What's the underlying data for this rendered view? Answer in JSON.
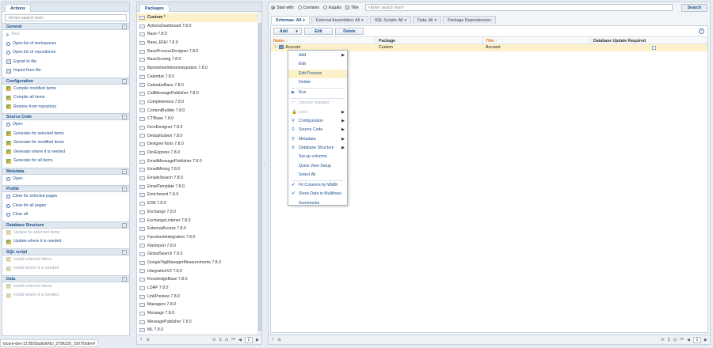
{
  "actions": {
    "tab_label": "Actions",
    "search_placeholder": "<Enter search text>",
    "groups": [
      {
        "title": "General",
        "items": [
          {
            "label": "Run",
            "icon": "run-icon",
            "disabled": true
          },
          {
            "label": "Open list of workspaces",
            "icon": "search-icon",
            "disabled": false
          },
          {
            "label": "Open list of repositories",
            "icon": "search-icon",
            "disabled": false
          },
          {
            "label": "Export to file",
            "icon": "export-icon",
            "disabled": false
          },
          {
            "label": "Import from file",
            "icon": "import-icon",
            "disabled": false
          }
        ]
      },
      {
        "title": "Configuration",
        "items": [
          {
            "label": "Compile modified items",
            "icon": "compile-icon",
            "disabled": false
          },
          {
            "label": "Compile all items",
            "icon": "compile-icon",
            "disabled": false
          },
          {
            "label": "Restore from repository",
            "icon": "restore-icon",
            "disabled": false
          }
        ]
      },
      {
        "title": "Source Code",
        "items": [
          {
            "label": "Open",
            "icon": "search-icon",
            "disabled": false
          },
          {
            "label": "Generate for selected items",
            "icon": "generate-icon",
            "disabled": false
          },
          {
            "label": "Generate for modified items",
            "icon": "generate-icon",
            "disabled": false
          },
          {
            "label": "Generate where it is needed",
            "icon": "generate-icon",
            "disabled": false
          },
          {
            "label": "Generate for all items",
            "icon": "generate-icon",
            "disabled": false
          }
        ]
      },
      {
        "title": "Metadata",
        "items": [
          {
            "label": "Open",
            "icon": "search-icon",
            "disabled": false
          }
        ]
      },
      {
        "title": "Profile",
        "items": [
          {
            "label": "Clear for selected pages",
            "icon": "search-icon",
            "disabled": false
          },
          {
            "label": "Clear for all pages",
            "icon": "search-icon",
            "disabled": false
          },
          {
            "label": "Clear all",
            "icon": "search-icon",
            "disabled": false
          }
        ]
      },
      {
        "title": "Database Structure",
        "items": [
          {
            "label": "Update for selected items",
            "icon": "database-icon",
            "disabled": true
          },
          {
            "label": "Update where it is needed",
            "icon": "database-icon",
            "disabled": false
          }
        ]
      },
      {
        "title": "SQL script",
        "items": [
          {
            "label": "Install selected items",
            "icon": "install-icon",
            "disabled": true
          },
          {
            "label": "Install where it is needed",
            "icon": "install-icon",
            "disabled": true
          }
        ]
      },
      {
        "title": "Data",
        "items": [
          {
            "label": "Install selected items",
            "icon": "install-icon",
            "disabled": true
          },
          {
            "label": "Install where it is needed",
            "icon": "install-icon",
            "disabled": true
          }
        ]
      }
    ]
  },
  "status_url": "tscore-dev-12:85/StudioENU_2796220_1007/0/dev#",
  "packages": {
    "tab_label": "Packages",
    "selected": "Custom *",
    "items": [
      "ActionsDashboard 7.8.0",
      "Base 7.8.0",
      "Base_ENU 7.8.0",
      "BaseProcessDesigner 7.8.0",
      "BaseScoring 7.8.0",
      "Bpmonline0nlineIntegration 7.8.0",
      "Calendar 7.8.0",
      "CalendarBase 7.8.0",
      "CallMessagePublisher 7.8.0",
      "Completeness 7.8.0",
      "ContentBuilder 7.8.0",
      "CTIBase 7.8.0",
      "DcmDesigner 7.8.0",
      "Deduplication 7.8.0",
      "DesignerTools 7.8.0",
      "DevExpress 7.8.0",
      "EmailMessagePublisher 7.8.0",
      "EmailMining 7.8.0",
      "EmailsSearch 7.8.0",
      "EmailTemplate 7.8.0",
      "Enrichment 7.8.0",
      "ESN 7.8.0",
      "Exchange 7.8.0",
      "ExchangeListener 7.8.0",
      "ExternalAccess 7.8.0",
      "FacebookIntegration 7.8.0",
      "FileImport 7.8.0",
      "GlobalSearch 7.8.0",
      "GoogleTagManagerMeasurements 7.8.0",
      "IntegrationV2 7.8.0",
      "KnowledgeBase 7.8.0",
      "LDAP 7.8.0",
      "LinkPreview 7.8.0",
      "Managers 7.8.0",
      "Message 7.8.0",
      "MessagePublisher 7.8.0",
      "ML 7.8.0"
    ],
    "pager_value": "1"
  },
  "filter": {
    "start_with": "Start with",
    "contains": "Contains",
    "equals": "Equals",
    "title": "Title",
    "search_placeholder": "<Enter search text>",
    "search_button": "Search"
  },
  "tabs": [
    {
      "label": "Schemas: All",
      "active": true
    },
    {
      "label": "External Assemblies: All",
      "active": false
    },
    {
      "label": "SQL Scripts: All",
      "active": false
    },
    {
      "label": "Data: All",
      "active": false
    },
    {
      "label": "Package Dependencies",
      "active": false
    }
  ],
  "toolbar": {
    "add": "Add",
    "edit": "Edit",
    "delete": "Delete"
  },
  "grid": {
    "columns": [
      "Name",
      "Package",
      "Title",
      "Database Update Required"
    ],
    "rows": [
      {
        "name": "Account",
        "package": "Custom",
        "title": "Account",
        "db_update": false
      }
    ]
  },
  "context_menu": [
    {
      "label": "Add",
      "submenu": true,
      "disabled": false
    },
    {
      "label": "Edit",
      "submenu": false,
      "disabled": false
    },
    {
      "label": "Edit Process",
      "submenu": false,
      "disabled": false,
      "hover": true
    },
    {
      "label": "Delete",
      "submenu": false,
      "disabled": false
    },
    {
      "sep": true
    },
    {
      "label": "Run",
      "submenu": false,
      "disabled": false,
      "lead": "run"
    },
    {
      "sep": true
    },
    {
      "label": "Discard changes",
      "submenu": false,
      "disabled": true,
      "lead": "undo"
    },
    {
      "label": "Lock",
      "submenu": true,
      "disabled": true,
      "lead": "lock"
    },
    {
      "label": "Configuration",
      "submenu": true,
      "disabled": false,
      "lead": "search"
    },
    {
      "label": "Source Code",
      "submenu": true,
      "disabled": false,
      "lead": "search"
    },
    {
      "label": "Metadata",
      "submenu": true,
      "disabled": false,
      "lead": "search"
    },
    {
      "label": "Database Structure",
      "submenu": true,
      "disabled": false,
      "lead": "search"
    },
    {
      "label": "Set up columns",
      "submenu": false,
      "disabled": false
    },
    {
      "label": "Quick View Setup",
      "submenu": false,
      "disabled": false
    },
    {
      "label": "Select All",
      "submenu": false,
      "disabled": false
    },
    {
      "sep": true
    },
    {
      "label": "Fit Columns by Width",
      "submenu": false,
      "disabled": false,
      "lead": "check"
    },
    {
      "label": "Show Data in Multilines",
      "submenu": false,
      "disabled": false,
      "lead": "check"
    },
    {
      "label": "Summaries",
      "submenu": false,
      "disabled": false
    }
  ],
  "main_pager_value": "1"
}
